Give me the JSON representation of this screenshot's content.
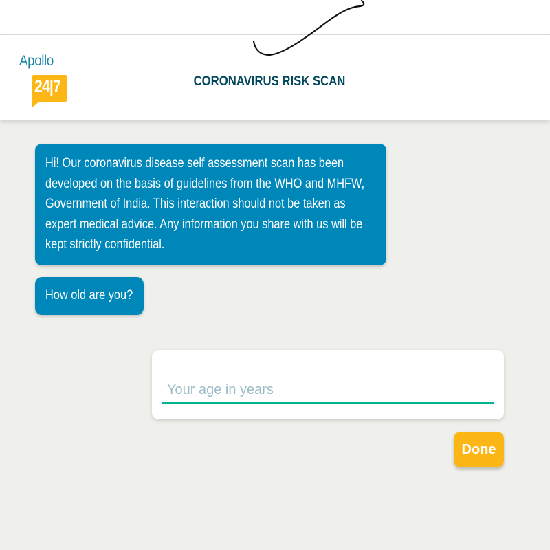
{
  "header": {
    "logo_word": "Apollo",
    "logo_number": "24|7",
    "title": "CORONAVIRUS RISK SCAN"
  },
  "chat": {
    "messages": [
      "Hi! Our coronavirus disease self assessment scan has been developed on the basis of guidelines from the WHO and MHFW, Government of India. This interaction should not be taken as expert medical advice. Any information you share with us will be kept strictly confidential.",
      "How old are you?"
    ]
  },
  "age_input": {
    "value": "",
    "placeholder": "Your age in years"
  },
  "done_label": "Done",
  "colors": {
    "bubble": "#0087ba",
    "accent": "#fcb716",
    "title": "#02475b",
    "input_underline": "#00b38e",
    "background": "#efefeb"
  },
  "icons": {
    "scribble": "handwritten-check-mark"
  }
}
